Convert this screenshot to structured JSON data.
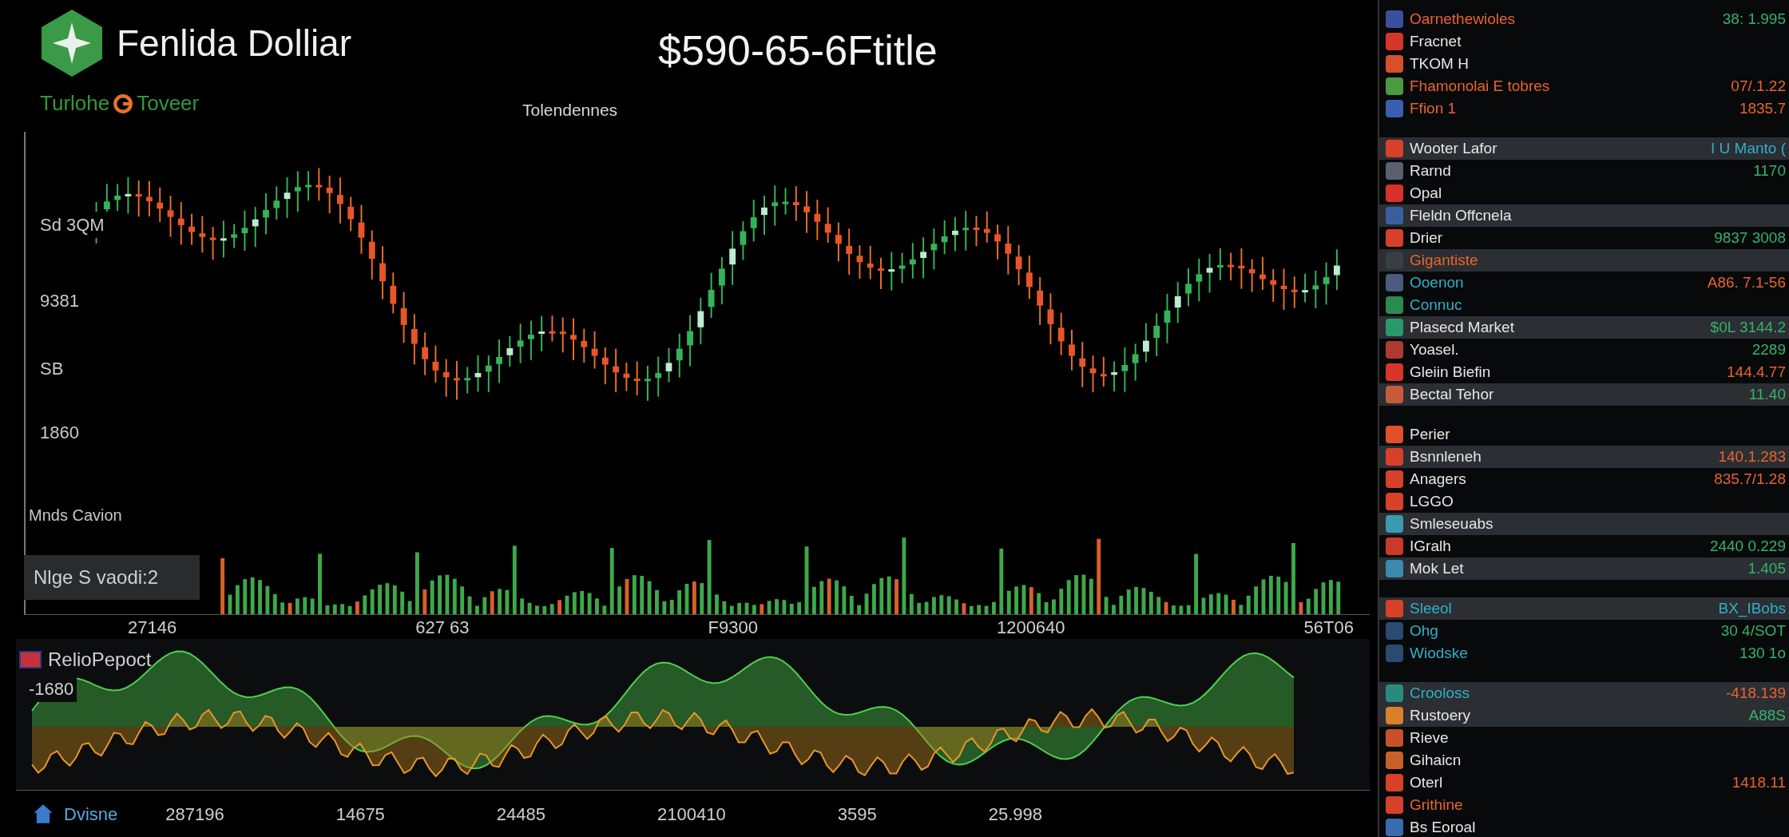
{
  "header": {
    "title": "Fenlida Dolliar",
    "price": "$590-65-6Ftitle",
    "subtitle": "Tolendennes",
    "ticker_left": "Turlohe",
    "ticker_right": "Toveer"
  },
  "main_chart": {
    "y_labels": [
      "Sd 3QM",
      "9381",
      "SB",
      "1860"
    ],
    "volume_label": "Mnds Cavion",
    "volume_box": "Nlge S vaodi:2",
    "x_labels": [
      "27146",
      "627 63",
      "F9300",
      "1200640",
      "56T06"
    ]
  },
  "lower_chart": {
    "title": "RelioPepoct",
    "level_label": "-1680",
    "x_labels": [
      "287196",
      "14675",
      "24485",
      "2100410",
      "3595",
      "25.998"
    ],
    "footer_label": "Dvisne"
  },
  "watchlist": {
    "groups": [
      {
        "rows": [
          {
            "label": {
              "text": "Oarnethewioles",
              "kind": "alert"
            },
            "quote": {
              "text": "38: 1.995",
              "kind": "gain"
            },
            "color": "#3a4fa0",
            "highlighted": false
          },
          {
            "label": {
              "text": "Fracnet",
              "kind": "plain"
            },
            "color": "#d8352a",
            "highlighted": false
          },
          {
            "label": {
              "text": "TKOM H",
              "kind": "plain"
            },
            "color": "#d8502a",
            "highlighted": false
          },
          {
            "label": {
              "text": "Fhamonolai E tobres",
              "kind": "alert"
            },
            "quote": {
              "text": "07/.1.22",
              "kind": "loss"
            },
            "color": "#4a9a40",
            "highlighted": false
          },
          {
            "label": {
              "text": "Ffion 1",
              "kind": "alert"
            },
            "quote": {
              "text": "1835.7",
              "kind": "loss"
            },
            "color": "#3a5fb0",
            "highlighted": false
          }
        ]
      },
      {
        "rows": [
          {
            "label": {
              "text": "Wooter Lafor",
              "kind": "plain"
            },
            "quote": {
              "text": "I U Manto (",
              "kind": "info"
            },
            "color": "#d8402a",
            "highlighted": true
          },
          {
            "label": {
              "text": "Rarnd",
              "kind": "plain"
            },
            "quote": {
              "text": "1170",
              "kind": "gain"
            },
            "color": "#5a6070",
            "highlighted": false
          },
          {
            "label": {
              "text": "Opal",
              "kind": "plain"
            },
            "color": "#d8302a",
            "highlighted": false
          },
          {
            "label": {
              "text": "Fleldn Offcnela",
              "kind": "plain"
            },
            "color": "#3a5fa0",
            "highlighted": true
          },
          {
            "label": {
              "text": "Drier",
              "kind": "plain"
            },
            "quote": {
              "text": "9837 3008",
              "kind": "gain"
            },
            "color": "#d8402a",
            "highlighted": false
          },
          {
            "label": {
              "text": "Gigantiste",
              "kind": "alert"
            },
            "color": "#3a3d44",
            "highlighted": true
          },
          {
            "label": {
              "text": "Ooenon",
              "kind": "info"
            },
            "quote": {
              "text": "A86. 7.1-56",
              "kind": "loss"
            },
            "color": "#4a5a80",
            "highlighted": false
          },
          {
            "label": {
              "text": "Connuc",
              "kind": "info"
            },
            "color": "#2a8a50",
            "highlighted": false
          },
          {
            "label": {
              "text": "Plasecd Market",
              "kind": "plain"
            },
            "quote": {
              "text": "$0L 3144.2",
              "kind": "gain"
            },
            "color": "#2a9a6a",
            "highlighted": true
          },
          {
            "label": {
              "text": "Yoasel.",
              "kind": "plain"
            },
            "quote": {
              "text": "2289",
              "kind": "gain"
            },
            "color": "#b03a30",
            "highlighted": false
          },
          {
            "label": {
              "text": "Gleiin Biefin",
              "kind": "plain"
            },
            "quote": {
              "text": "144.4.77",
              "kind": "loss"
            },
            "color": "#d8352a",
            "highlighted": false
          },
          {
            "label": {
              "text": "Bectal Tehor",
              "kind": "plain"
            },
            "quote": {
              "text": "11.40",
              "kind": "gain"
            },
            "color": "#c85a3a",
            "highlighted": true
          }
        ]
      },
      {
        "rows": [
          {
            "label": {
              "text": "Perier",
              "kind": "plain"
            },
            "color": "#e0502a",
            "highlighted": false
          },
          {
            "label": {
              "text": "Bsnnleneh",
              "kind": "plain"
            },
            "quote": {
              "text": "140.1.283",
              "kind": "loss"
            },
            "color": "#d8402a",
            "highlighted": true
          },
          {
            "label": {
              "text": "Anagers",
              "kind": "plain"
            },
            "quote": {
              "text": "835.7/1.28",
              "kind": "loss"
            },
            "color": "#d8402a",
            "highlighted": false
          },
          {
            "label": {
              "text": "LGGO",
              "kind": "plain"
            },
            "color": "#d8402a",
            "highlighted": false
          },
          {
            "label": {
              "text": "Smleseuabs",
              "kind": "plain"
            },
            "color": "#3a9ab0",
            "highlighted": true
          },
          {
            "label": {
              "text": "IGralh",
              "kind": "plain"
            },
            "quote": {
              "text": "2440 0.229",
              "kind": "gain"
            },
            "color": "#c83a2a",
            "highlighted": false
          },
          {
            "label": {
              "text": "Mok Let",
              "kind": "plain"
            },
            "quote": {
              "text": "1.405",
              "kind": "gain"
            },
            "color": "#3a8ab0",
            "highlighted": true
          }
        ]
      },
      {
        "rows": [
          {
            "label": {
              "text": "Sleeol",
              "kind": "info"
            },
            "quote": {
              "text": "BX_IBobs",
              "kind": "info"
            },
            "color": "#d8402a",
            "highlighted": true
          },
          {
            "label": {
              "text": "Ohg",
              "kind": "info"
            },
            "quote": {
              "text": "30 4/SOT",
              "kind": "gain"
            },
            "color": "#2a4a70",
            "highlighted": false
          },
          {
            "label": {
              "text": "Wiodske",
              "kind": "info"
            },
            "quote": {
              "text": "130 1o",
              "kind": "gain"
            },
            "color": "#2a4a70",
            "highlighted": false
          }
        ]
      },
      {
        "rows": [
          {
            "label": {
              "text": "Crooloss",
              "kind": "info"
            },
            "quote": {
              "text": "-418.139",
              "kind": "loss"
            },
            "color": "#2a8a80",
            "highlighted": true
          },
          {
            "label": {
              "text": "Rustoery",
              "kind": "plain"
            },
            "quote": {
              "text": "A88S",
              "kind": "gain"
            },
            "color": "#d8802a",
            "highlighted": true
          },
          {
            "label": {
              "text": "Rieve",
              "kind": "plain"
            },
            "color": "#c8502a",
            "highlighted": false
          },
          {
            "label": {
              "text": "Gihaicn",
              "kind": "plain"
            },
            "color": "#c8602a",
            "highlighted": false
          },
          {
            "label": {
              "text": "Oterl",
              "kind": "plain"
            },
            "quote": {
              "text": "1418.11",
              "kind": "loss"
            },
            "color": "#d8402a",
            "highlighted": false
          },
          {
            "label": {
              "text": "Grithine",
              "kind": "alert"
            },
            "color": "#d8402a",
            "highlighted": false
          },
          {
            "label": {
              "text": "Bs Eoroal",
              "kind": "plain"
            },
            "color": "#3a6ab0",
            "highlighted": false
          }
        ]
      }
    ]
  }
}
